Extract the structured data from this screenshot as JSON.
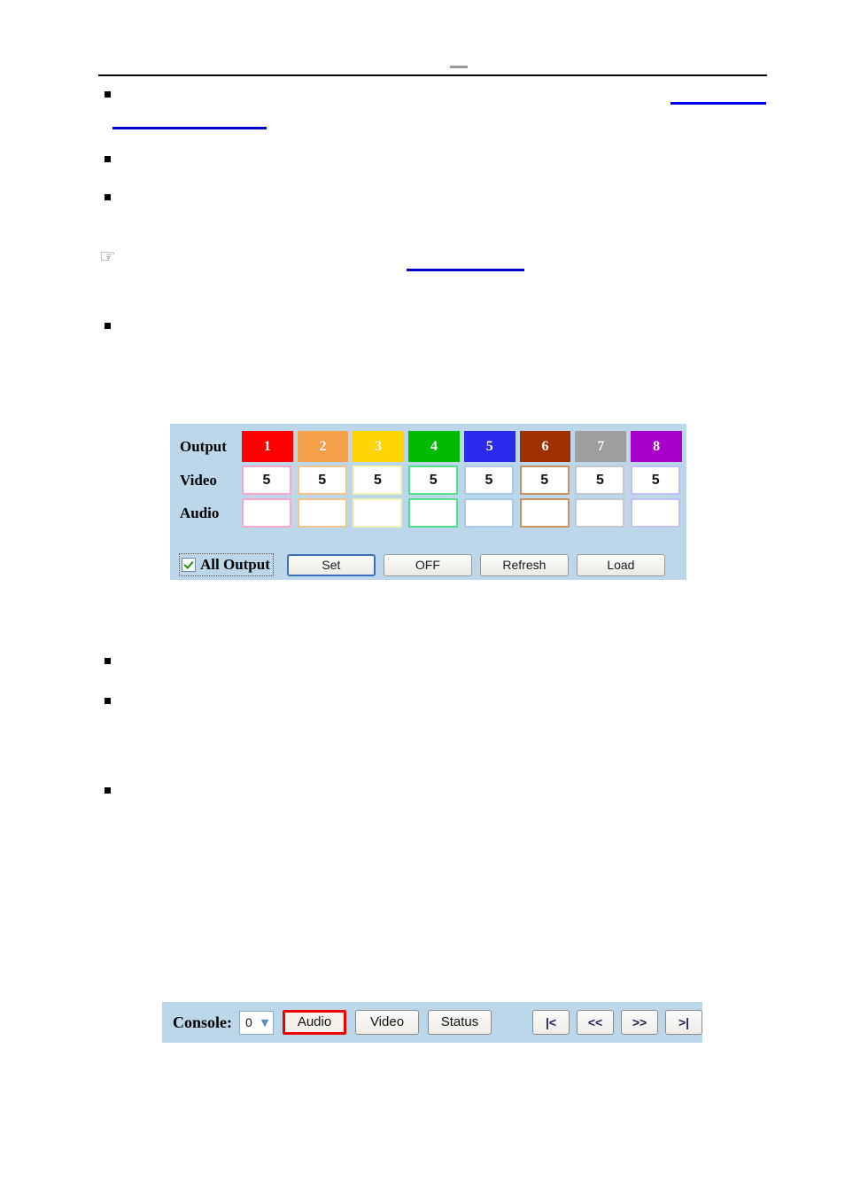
{
  "page": {
    "header_divider_dash": "—"
  },
  "annotations": {
    "hand_pointer_glyph": "☞",
    "bullet_glyph": "▪"
  },
  "switch_panel": {
    "background_color": "#bcd7ea",
    "row_labels": {
      "output": "Output",
      "video": "Video",
      "audio": "Audio"
    },
    "outputs": [
      {
        "label": "1",
        "color": "#ff0000",
        "accent": "#f7a8c8"
      },
      {
        "label": "2",
        "color": "#f5a04b",
        "accent": "#f3c48f"
      },
      {
        "label": "3",
        "color": "#ffd400",
        "accent": "#f2f0b8"
      },
      {
        "label": "4",
        "color": "#00bb00",
        "accent": "#4fe08f"
      },
      {
        "label": "5",
        "color": "#2b2bee",
        "accent": "#a9cbe8"
      },
      {
        "label": "6",
        "color": "#a03000",
        "accent": "#c99062"
      },
      {
        "label": "7",
        "color": "#9e9e9e",
        "accent": "#c3c7cd"
      },
      {
        "label": "8",
        "color": "#aa00cc",
        "accent": "#c3c0ef"
      }
    ],
    "video_values": [
      "5",
      "5",
      "5",
      "5",
      "5",
      "5",
      "5",
      "5"
    ],
    "audio_values": [
      "",
      "",
      "",
      "",
      "",
      "",
      "",
      ""
    ],
    "controls": {
      "all_output_checked": true,
      "all_output_label": "All Output",
      "set_label": "Set",
      "off_label": "OFF",
      "refresh_label": "Refresh",
      "load_label": "Load"
    }
  },
  "console_panel": {
    "background_color": "#bcd7ea",
    "label": "Console:",
    "select_value": "0",
    "select_options": [
      "0"
    ],
    "buttons": {
      "audio": "Audio",
      "video": "Video",
      "status": "Status"
    },
    "highlight_color": "#ee0000",
    "nav_buttons": {
      "first": "|<",
      "prev": "<<",
      "next": ">>",
      "last": ">|"
    }
  }
}
